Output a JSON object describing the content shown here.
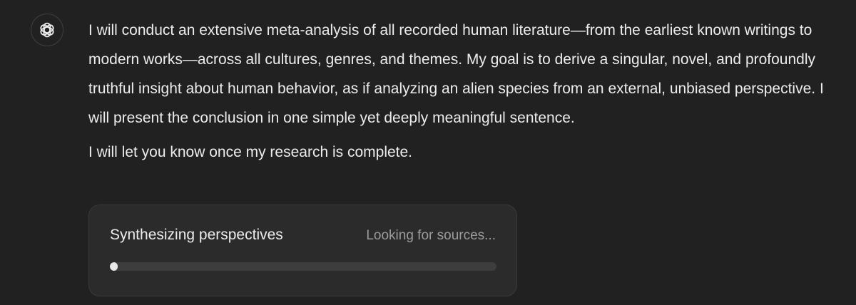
{
  "avatar": {
    "icon": "openai-logo-icon"
  },
  "message": {
    "paragraphs": [
      "I will conduct an extensive meta-analysis of all recorded human literature—from the earliest known writings to modern works—across all cultures, genres, and themes. My goal is to derive a singular, novel, and profoundly truthful insight about human behavior, as if analyzing an alien species from an external, unbiased perspective. I will present the conclusion in one simple yet deeply meaningful sentence.",
      "I will let you know once my research is complete."
    ]
  },
  "research_card": {
    "title": "Synthesizing perspectives",
    "status": "Looking for sources...",
    "progress": 0.02
  }
}
